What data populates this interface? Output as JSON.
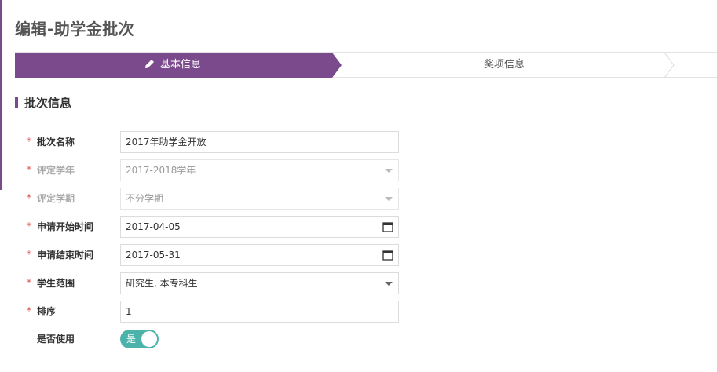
{
  "page": {
    "title": "编辑-助学金批次"
  },
  "steps": [
    {
      "label": "基本信息",
      "active": true,
      "icon": "pencil-icon"
    },
    {
      "label": "奖项信息",
      "active": false
    }
  ],
  "section": {
    "title": "批次信息"
  },
  "form": {
    "batch_name": {
      "label": "批次名称",
      "value": "2017年助学金开放",
      "required": true
    },
    "academic_year": {
      "label": "评定学年",
      "value": "2017-2018学年",
      "required": true,
      "disabled": true
    },
    "semester": {
      "label": "评定学期",
      "value": "不分学期",
      "required": true,
      "disabled": true
    },
    "apply_start": {
      "label": "申请开始时间",
      "value": "2017-04-05",
      "required": true,
      "icon": "calendar-icon"
    },
    "apply_end": {
      "label": "申请结束时间",
      "value": "2017-05-31",
      "required": true,
      "icon": "calendar-icon"
    },
    "student_scope": {
      "label": "学生范围",
      "value": "研究生, 本专科生",
      "required": true
    },
    "sort": {
      "label": "排序",
      "value": "1",
      "required": true
    },
    "enabled": {
      "label": "是否使用",
      "value": "是",
      "on": true
    }
  },
  "required_mark": "*",
  "colors": {
    "accent": "#7b4a8c",
    "required": "#d9534f",
    "toggle": "#4cb3aa"
  }
}
